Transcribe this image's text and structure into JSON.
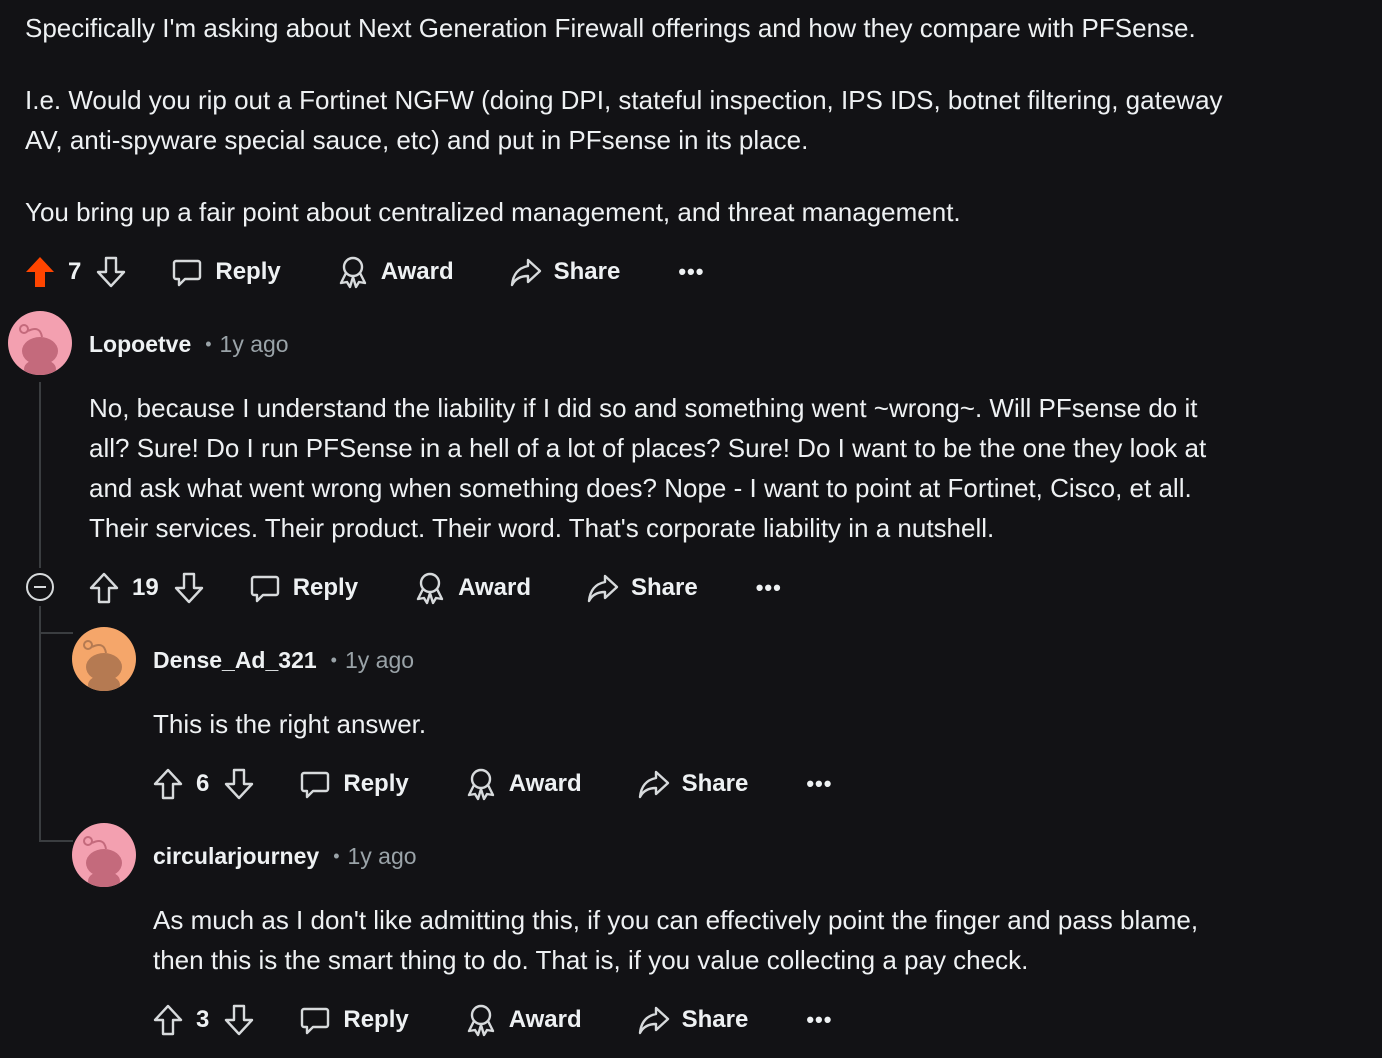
{
  "parent": {
    "paragraphs": [
      "Specifically I'm asking about Next Generation Firewall offerings and how they compare with PFSense.",
      "I.e. Would you rip out a Fortinet NGFW (doing DPI, stateful inspection, IPS IDS, botnet filtering, gateway",
      "AV, anti-spyware special sauce, etc) and put in PFsense in its place.",
      "You bring up a fair point about centralized management, and threat management."
    ],
    "actions": {
      "votes": "7",
      "reply": "Reply",
      "award": "Award",
      "share": "Share",
      "more": "•••",
      "upvoted": true
    }
  },
  "comments": [
    {
      "username": "Lopoetve",
      "separator": "•",
      "time": "1y ago",
      "avatar_color": "#f3a0b0",
      "lines": [
        "No, because I understand the liability if I did so and something went ~wrong~. Will PFsense do it",
        "all? Sure! Do I run PFSense in a hell of a lot of places? Sure! Do I want to be the one they look at",
        "and ask what went wrong when something does? Nope - I want to point at Fortinet, Cisco, et all.",
        "Their services. Their product. Their word. That's corporate liability in a nutshell."
      ],
      "actions": {
        "votes": "19",
        "reply": "Reply",
        "award": "Award",
        "share": "Share",
        "more": "•••"
      }
    },
    {
      "username": "Dense_Ad_321",
      "separator": "•",
      "time": "1y ago",
      "avatar_color": "#f5a66a",
      "lines": [
        "This is the right answer."
      ],
      "actions": {
        "votes": "6",
        "reply": "Reply",
        "award": "Award",
        "share": "Share",
        "more": "•••"
      }
    },
    {
      "username": "circularjourney",
      "separator": "•",
      "time": "1y ago",
      "avatar_color": "#f3a0b0",
      "lines": [
        "As much as I don't like admitting this, if you can effectively point the finger and pass blame,",
        "then this is the smart thing to do. That is, if you value collecting a pay check."
      ],
      "actions": {
        "votes": "3",
        "reply": "Reply",
        "award": "Award",
        "share": "Share",
        "more": "•••"
      }
    }
  ],
  "colors": {
    "background": "#121215",
    "text": "#eef1f3",
    "muted": "#9aa3a8",
    "upvote": "#ff4500",
    "thread_line": "#3a3d40"
  }
}
